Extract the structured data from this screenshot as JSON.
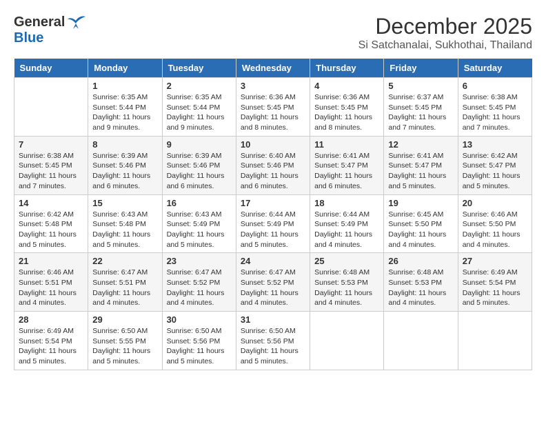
{
  "header": {
    "logo_general": "General",
    "logo_blue": "Blue",
    "month_title": "December 2025",
    "location": "Si Satchanalai, Sukhothai, Thailand"
  },
  "days_of_week": [
    "Sunday",
    "Monday",
    "Tuesday",
    "Wednesday",
    "Thursday",
    "Friday",
    "Saturday"
  ],
  "weeks": [
    [
      {
        "num": "",
        "sunrise": "",
        "sunset": "",
        "daylight": "",
        "empty": true
      },
      {
        "num": "1",
        "sunrise": "Sunrise: 6:35 AM",
        "sunset": "Sunset: 5:44 PM",
        "daylight": "Daylight: 11 hours and 9 minutes."
      },
      {
        "num": "2",
        "sunrise": "Sunrise: 6:35 AM",
        "sunset": "Sunset: 5:44 PM",
        "daylight": "Daylight: 11 hours and 9 minutes."
      },
      {
        "num": "3",
        "sunrise": "Sunrise: 6:36 AM",
        "sunset": "Sunset: 5:45 PM",
        "daylight": "Daylight: 11 hours and 8 minutes."
      },
      {
        "num": "4",
        "sunrise": "Sunrise: 6:36 AM",
        "sunset": "Sunset: 5:45 PM",
        "daylight": "Daylight: 11 hours and 8 minutes."
      },
      {
        "num": "5",
        "sunrise": "Sunrise: 6:37 AM",
        "sunset": "Sunset: 5:45 PM",
        "daylight": "Daylight: 11 hours and 7 minutes."
      },
      {
        "num": "6",
        "sunrise": "Sunrise: 6:38 AM",
        "sunset": "Sunset: 5:45 PM",
        "daylight": "Daylight: 11 hours and 7 minutes."
      }
    ],
    [
      {
        "num": "7",
        "sunrise": "Sunrise: 6:38 AM",
        "sunset": "Sunset: 5:45 PM",
        "daylight": "Daylight: 11 hours and 7 minutes."
      },
      {
        "num": "8",
        "sunrise": "Sunrise: 6:39 AM",
        "sunset": "Sunset: 5:46 PM",
        "daylight": "Daylight: 11 hours and 6 minutes."
      },
      {
        "num": "9",
        "sunrise": "Sunrise: 6:39 AM",
        "sunset": "Sunset: 5:46 PM",
        "daylight": "Daylight: 11 hours and 6 minutes."
      },
      {
        "num": "10",
        "sunrise": "Sunrise: 6:40 AM",
        "sunset": "Sunset: 5:46 PM",
        "daylight": "Daylight: 11 hours and 6 minutes."
      },
      {
        "num": "11",
        "sunrise": "Sunrise: 6:41 AM",
        "sunset": "Sunset: 5:47 PM",
        "daylight": "Daylight: 11 hours and 6 minutes."
      },
      {
        "num": "12",
        "sunrise": "Sunrise: 6:41 AM",
        "sunset": "Sunset: 5:47 PM",
        "daylight": "Daylight: 11 hours and 5 minutes."
      },
      {
        "num": "13",
        "sunrise": "Sunrise: 6:42 AM",
        "sunset": "Sunset: 5:47 PM",
        "daylight": "Daylight: 11 hours and 5 minutes."
      }
    ],
    [
      {
        "num": "14",
        "sunrise": "Sunrise: 6:42 AM",
        "sunset": "Sunset: 5:48 PM",
        "daylight": "Daylight: 11 hours and 5 minutes."
      },
      {
        "num": "15",
        "sunrise": "Sunrise: 6:43 AM",
        "sunset": "Sunset: 5:48 PM",
        "daylight": "Daylight: 11 hours and 5 minutes."
      },
      {
        "num": "16",
        "sunrise": "Sunrise: 6:43 AM",
        "sunset": "Sunset: 5:49 PM",
        "daylight": "Daylight: 11 hours and 5 minutes."
      },
      {
        "num": "17",
        "sunrise": "Sunrise: 6:44 AM",
        "sunset": "Sunset: 5:49 PM",
        "daylight": "Daylight: 11 hours and 5 minutes."
      },
      {
        "num": "18",
        "sunrise": "Sunrise: 6:44 AM",
        "sunset": "Sunset: 5:49 PM",
        "daylight": "Daylight: 11 hours and 4 minutes."
      },
      {
        "num": "19",
        "sunrise": "Sunrise: 6:45 AM",
        "sunset": "Sunset: 5:50 PM",
        "daylight": "Daylight: 11 hours and 4 minutes."
      },
      {
        "num": "20",
        "sunrise": "Sunrise: 6:46 AM",
        "sunset": "Sunset: 5:50 PM",
        "daylight": "Daylight: 11 hours and 4 minutes."
      }
    ],
    [
      {
        "num": "21",
        "sunrise": "Sunrise: 6:46 AM",
        "sunset": "Sunset: 5:51 PM",
        "daylight": "Daylight: 11 hours and 4 minutes."
      },
      {
        "num": "22",
        "sunrise": "Sunrise: 6:47 AM",
        "sunset": "Sunset: 5:51 PM",
        "daylight": "Daylight: 11 hours and 4 minutes."
      },
      {
        "num": "23",
        "sunrise": "Sunrise: 6:47 AM",
        "sunset": "Sunset: 5:52 PM",
        "daylight": "Daylight: 11 hours and 4 minutes."
      },
      {
        "num": "24",
        "sunrise": "Sunrise: 6:47 AM",
        "sunset": "Sunset: 5:52 PM",
        "daylight": "Daylight: 11 hours and 4 minutes."
      },
      {
        "num": "25",
        "sunrise": "Sunrise: 6:48 AM",
        "sunset": "Sunset: 5:53 PM",
        "daylight": "Daylight: 11 hours and 4 minutes."
      },
      {
        "num": "26",
        "sunrise": "Sunrise: 6:48 AM",
        "sunset": "Sunset: 5:53 PM",
        "daylight": "Daylight: 11 hours and 4 minutes."
      },
      {
        "num": "27",
        "sunrise": "Sunrise: 6:49 AM",
        "sunset": "Sunset: 5:54 PM",
        "daylight": "Daylight: 11 hours and 5 minutes."
      }
    ],
    [
      {
        "num": "28",
        "sunrise": "Sunrise: 6:49 AM",
        "sunset": "Sunset: 5:54 PM",
        "daylight": "Daylight: 11 hours and 5 minutes."
      },
      {
        "num": "29",
        "sunrise": "Sunrise: 6:50 AM",
        "sunset": "Sunset: 5:55 PM",
        "daylight": "Daylight: 11 hours and 5 minutes."
      },
      {
        "num": "30",
        "sunrise": "Sunrise: 6:50 AM",
        "sunset": "Sunset: 5:56 PM",
        "daylight": "Daylight: 11 hours and 5 minutes."
      },
      {
        "num": "31",
        "sunrise": "Sunrise: 6:50 AM",
        "sunset": "Sunset: 5:56 PM",
        "daylight": "Daylight: 11 hours and 5 minutes."
      },
      {
        "num": "",
        "sunrise": "",
        "sunset": "",
        "daylight": "",
        "empty": true
      },
      {
        "num": "",
        "sunrise": "",
        "sunset": "",
        "daylight": "",
        "empty": true
      },
      {
        "num": "",
        "sunrise": "",
        "sunset": "",
        "daylight": "",
        "empty": true
      }
    ]
  ]
}
